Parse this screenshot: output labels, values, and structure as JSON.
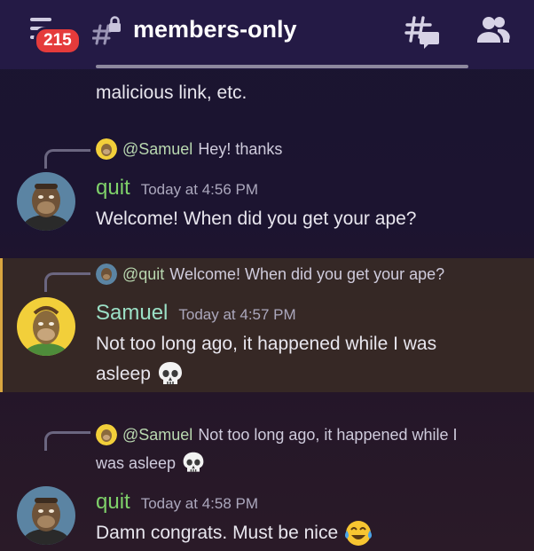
{
  "header": {
    "unread_badge": "215",
    "channel_name": "members-only",
    "icons": {
      "menu": "hamburger-menu-icon",
      "channel": "locked-hash-channel-icon",
      "threads": "threads-icon",
      "members": "members-icon"
    }
  },
  "colors": {
    "topbar": "#241a45",
    "badge": "#e53b3b",
    "quit_name": "#7fd16a",
    "samuel_name": "#9be0c6",
    "highlight_border": "#d9a640"
  },
  "messages": [
    {
      "id": "m0",
      "text": "malicious link, etc."
    },
    {
      "id": "m1",
      "reply_to": {
        "mention": "@Samuel",
        "text": "Hey! thanks"
      },
      "author": "quit",
      "time": "Today at 4:56 PM",
      "text": "Welcome! When did you get your ape?"
    },
    {
      "id": "m2",
      "highlighted": true,
      "reply_to": {
        "mention": "@quit",
        "text": "Welcome! When did you get your ape?"
      },
      "author": "Samuel",
      "time": "Today at 4:57 PM",
      "text_line1": "Not too long ago, it happened while I was",
      "text_line2": "asleep",
      "emoji": "skull-emoji"
    },
    {
      "id": "m3",
      "reply_to": {
        "mention": "@Samuel",
        "text_line1": "Not too long ago, it happened while I",
        "text_line2": "was asleep",
        "emoji": "skull-emoji"
      },
      "author": "quit",
      "time": "Today at 4:58 PM",
      "text": "Damn congrats. Must be nice",
      "emoji": "tears-of-joy-emoji"
    }
  ]
}
